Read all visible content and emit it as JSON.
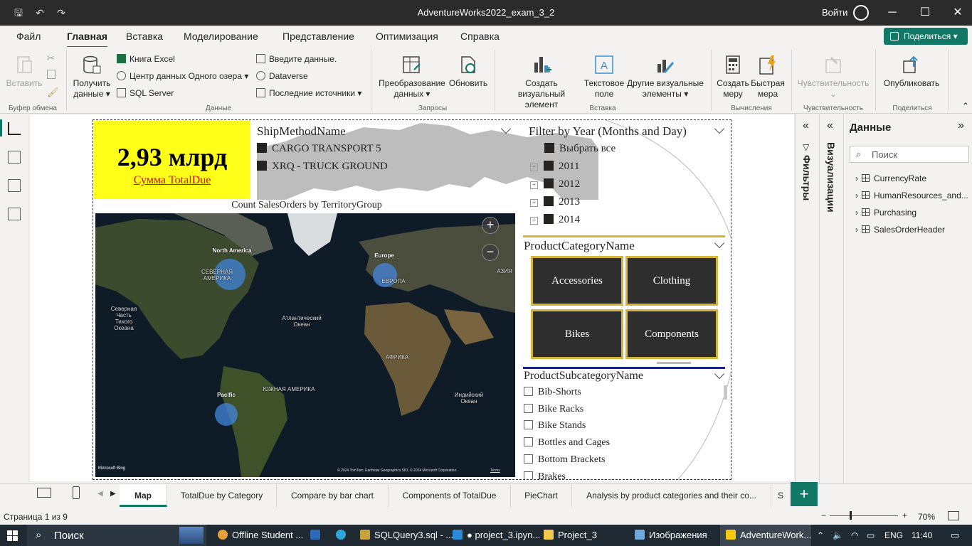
{
  "titlebar": {
    "title": "AdventureWorks2022_exam_3_2",
    "signin": "Войти"
  },
  "menu": {
    "tabs": [
      "Файл",
      "Главная",
      "Вставка",
      "Моделирование",
      "Представление",
      "Оптимизация",
      "Справка"
    ],
    "active": "Главная",
    "share": "Поделиться"
  },
  "ribbon": {
    "paste": "Вставить",
    "get_data_1": "Получить",
    "get_data_2": "данные",
    "excel": "Книга Excel",
    "onelake": "Центр данных Одного озера",
    "sql": "SQL Server",
    "enter_data": "Введите данные.",
    "dataverse": "Dataverse",
    "recent": "Последние источники",
    "transform_1": "Преобразование",
    "transform_2": "данных",
    "refresh": "Обновить",
    "new_visual_1": "Создать визуальный",
    "new_visual_2": "элемент",
    "textbox_1": "Текстовое",
    "textbox_2": "поле",
    "more_visuals_1": "Другие визуальные",
    "more_visuals_2": "элементы",
    "new_measure_1": "Создать",
    "new_measure_2": "меру",
    "quick_measure_1": "Быстрая",
    "quick_measure_2": "мера",
    "sensitivity": "Чувствительность",
    "publish": "Опубликовать",
    "groups": {
      "clipboard": "Буфер обмена",
      "data": "Данные",
      "queries": "Запросы",
      "insert": "Вставка",
      "calc": "Вычисления",
      "sens": "Чувствительность",
      "share": "Поделиться"
    }
  },
  "report": {
    "kpi": {
      "value": "2,93 млрд",
      "label": "Сумма TotalDue"
    },
    "ship": {
      "title": "ShipMethodName",
      "items": [
        "CARGO TRANSPORT 5",
        "XRQ - TRUCK GROUND"
      ]
    },
    "year": {
      "title": "Filter by Year (Months and Day)",
      "select_all": "Выбрать все",
      "years": [
        "2011",
        "2012",
        "2013",
        "2014"
      ]
    },
    "category": {
      "title": "ProductCategoryName",
      "tiles": [
        "Accessories",
        "Clothing",
        "Bikes",
        "Components"
      ]
    },
    "subcategory": {
      "title": "ProductSubcategoryName",
      "items": [
        "Bib-Shorts",
        "Bike Racks",
        "Bike Stands",
        "Bottles and Cages",
        "Bottom Brackets",
        "Brakes"
      ]
    },
    "map": {
      "title": "Count SalesOrders by TerritoryGroup",
      "labels": {
        "na": "North America",
        "eu": "Europe",
        "pac": "Pacific"
      },
      "places": {
        "sev_am_1": "СЕВЕРНАЯ",
        "sev_am_2": "АМЕРИКА",
        "europe": "ЕВРОПА",
        "asia": "АЗИЯ",
        "africa": "АФРИКА",
        "south_am": "ЮЖНАЯ АМЕРИКА",
        "arctic_1": "Северная",
        "arctic_2": "Часть",
        "arctic_3": "Тихого",
        "arctic_4": "Океана",
        "atl_1": "Атлантический",
        "atl_2": "Океан",
        "ind_1": "Индийский",
        "ind_2": "Океан"
      },
      "copyright": "© 2024 TomTom, Earthstar Geographics SIO, © 2024 Microsoft Corporation",
      "terms": "Terms",
      "bing": "Microsoft Bing",
      "bubbles": [
        {
          "name": "North America",
          "size": "large"
        },
        {
          "name": "Europe",
          "size": "medium"
        },
        {
          "name": "Pacific",
          "size": "medium"
        }
      ]
    }
  },
  "panes": {
    "filters": "Фильтры",
    "visualizations": "Визуализации",
    "data": "Данные",
    "search_placeholder": "Поиск",
    "tables": [
      "CurrencyRate",
      "HumanResources_and...",
      "Purchasing",
      "SalesOrderHeader"
    ]
  },
  "pagetabs": [
    "Map",
    "TotalDue by Category",
    "Compare by bar chart",
    "Components of TotalDue",
    "PieChart",
    "Analysis by product categories and their co...",
    "S"
  ],
  "status": {
    "page": "Страница 1 из 9",
    "zoom": "70%"
  },
  "taskbar": {
    "search": "Поиск",
    "apps": [
      "Offline Student ...",
      "SQLQuery3.sql - ...",
      "● project_3.ipyn...",
      "Project_3",
      "Изображения",
      "AdventureWork..."
    ],
    "lang": "ENG",
    "time": "11:40"
  }
}
